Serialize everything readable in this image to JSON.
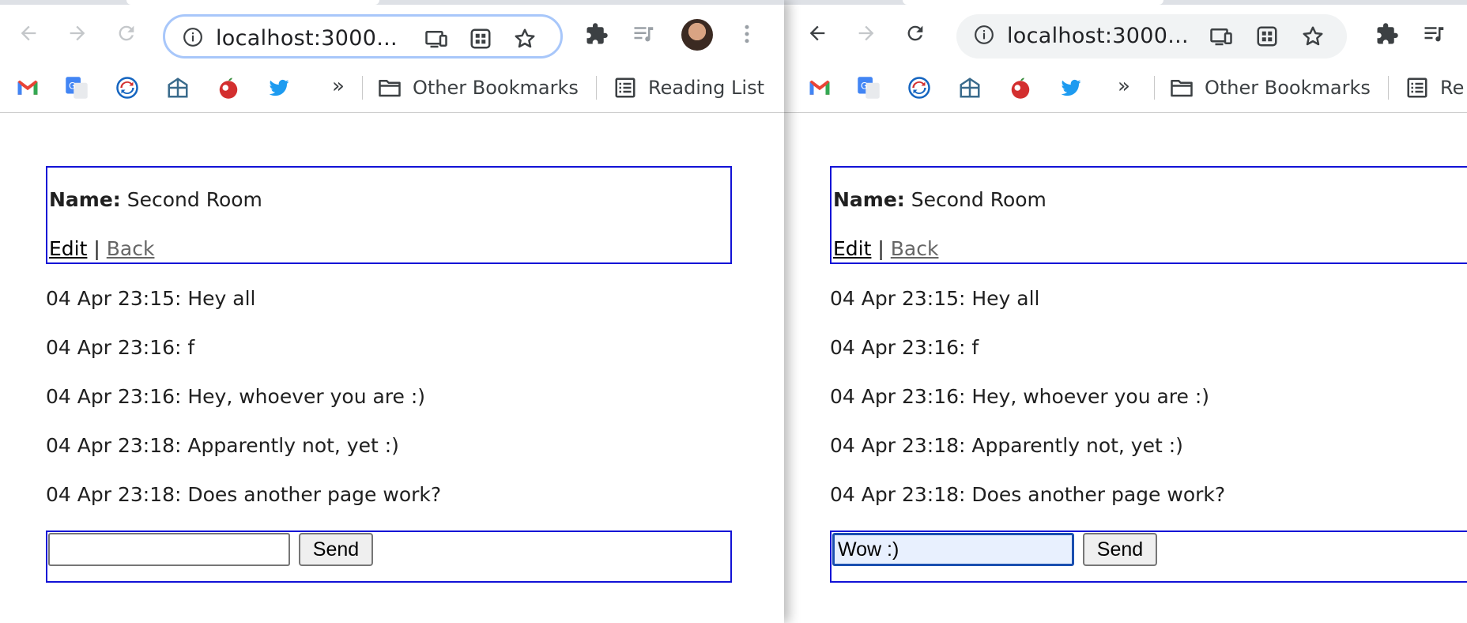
{
  "left_window": {
    "url": "localhost:3000...",
    "bookmarks": {
      "more": "»",
      "other_bookmarks": "Other Bookmarks",
      "reading_list": "Reading List"
    },
    "room": {
      "name_label": "Name:",
      "name_value": "Second Room",
      "edit_link": "Edit",
      "separator": "|",
      "back_link": "Back"
    },
    "messages": [
      "04 Apr 23:15: Hey all",
      "04 Apr 23:16: f",
      "04 Apr 23:16: Hey, whoever you are :)",
      "04 Apr 23:18: Apparently not, yet :)",
      "04 Apr 23:18: Does another page work?"
    ],
    "form": {
      "input_value": "",
      "send_label": "Send"
    }
  },
  "right_window": {
    "url": "localhost:3000...",
    "bookmarks": {
      "more": "»",
      "other_bookmarks": "Other Bookmarks",
      "reading_list": "Re"
    },
    "room": {
      "name_label": "Name:",
      "name_value": "Second Room",
      "edit_link": "Edit",
      "separator": "|",
      "back_link": "Back"
    },
    "messages": [
      "04 Apr 23:15: Hey all",
      "04 Apr 23:16: f",
      "04 Apr 23:16: Hey, whoever you are :)",
      "04 Apr 23:18: Apparently not, yet :)",
      "04 Apr 23:18: Does another page work?"
    ],
    "form": {
      "input_value": "Wow :)",
      "send_label": "Send"
    }
  },
  "colors": {
    "border_blue": "#1212d6",
    "focus_blue": "#1a4fb0",
    "gmail_red": "#ea4335",
    "twitter_blue": "#1d9bf0"
  },
  "icons": [
    "back-arrow-icon",
    "forward-arrow-icon",
    "reload-icon",
    "info-icon",
    "cast-icon",
    "qr-icon",
    "star-icon",
    "puzzle-icon",
    "media-icon",
    "kebab-menu-icon",
    "gmail-icon",
    "google-translate-icon",
    "sync-icon",
    "window-grid-icon",
    "apple-icon",
    "twitter-icon",
    "folder-icon",
    "reading-list-icon"
  ]
}
